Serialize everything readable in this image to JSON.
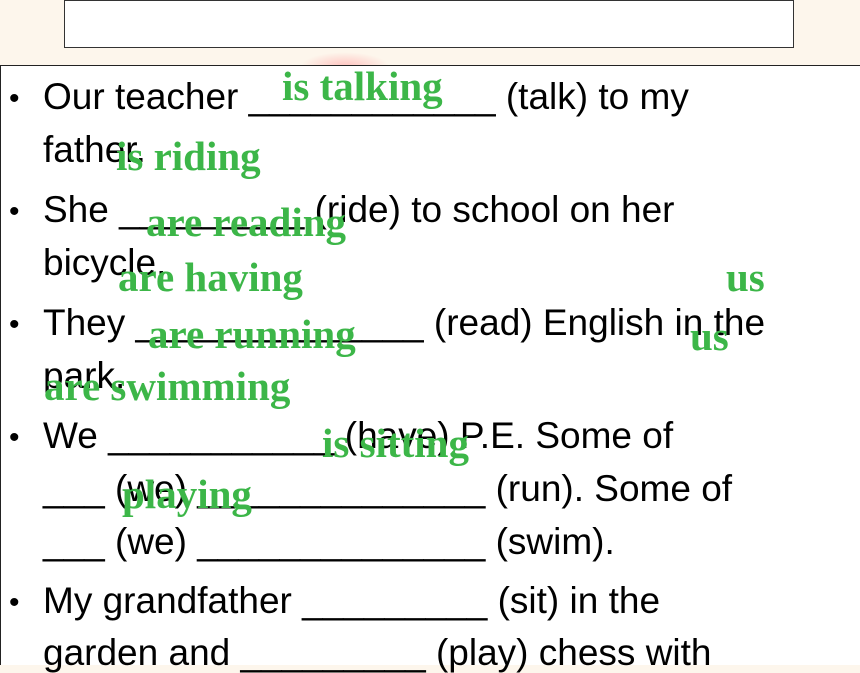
{
  "slide": {
    "title": "",
    "colors": {
      "answer": "#3cb648",
      "text": "#000000",
      "frame": "#222222"
    }
  },
  "exercises": [
    {
      "lines": [
        "Our teacher ____________ (talk) to my",
        "father."
      ]
    },
    {
      "lines": [
        "She _________ (ride) to school on her",
        "bicycle."
      ]
    },
    {
      "lines": [
        "They ______________ (read) English in the",
        "park."
      ]
    },
    {
      "lines": [
        "We ___________ (have) P.E. Some of",
        "___ (we) ______________ (run). Some of",
        "___ (we) ______________ (swim)."
      ]
    },
    {
      "lines": [
        "My grandfather _________ (sit) in the",
        "garden and _________ (play) chess with"
      ]
    }
  ],
  "answers": [
    "is talking",
    "is riding",
    "are reading",
    "are having",
    "us",
    "are running",
    "us",
    "are swimming",
    "is sitting",
    "playing"
  ]
}
